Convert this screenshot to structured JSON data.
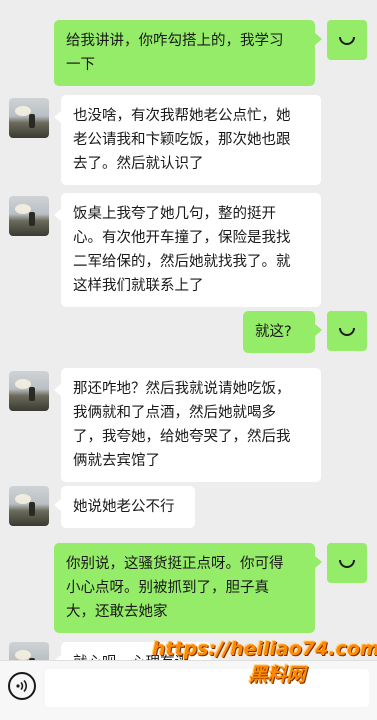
{
  "messages": [
    {
      "sender": "me",
      "lines": [
        "给我讲讲，你咋勾搭上的，我学习",
        "一下"
      ]
    },
    {
      "sender": "other",
      "lines": [
        "也没啥，有次我帮她老公点忙，她",
        "老公请我和卞颖吃饭，那次她也跟",
        "去了。然后就认识了"
      ]
    },
    {
      "sender": "other",
      "lines": [
        "饭桌上我夸了她几句，整的挺开",
        "心。有次他开车撞了，保险是我找",
        "二军给保的，然后她就找我了。就",
        "这样我们就联系上了"
      ]
    },
    {
      "sender": "me",
      "lines": [
        "就这?"
      ]
    },
    {
      "sender": "other",
      "lines": [
        "那还咋地？然后我就说请她吃饭，",
        "我俩就和了点酒，然后她就喝多",
        "了，我夸她，给她夸哭了，然后我",
        "俩就去宾馆了"
      ]
    },
    {
      "sender": "other",
      "lines": [
        "她说她老公不行"
      ]
    },
    {
      "sender": "me",
      "lines": [
        "你别说，这骚货挺正点呀。你可得",
        "小心点呀。别被抓到了，胆子真",
        "大，还敢去她家"
      ]
    },
    {
      "sender": "other",
      "lines": [
        "就心呗，心理有谱"
      ]
    }
  ],
  "input_bar": {
    "voice_icon": "voice-icon",
    "placeholder": ""
  },
  "watermark": {
    "url": "https://heiliao74.com",
    "brand": "黑料网"
  }
}
